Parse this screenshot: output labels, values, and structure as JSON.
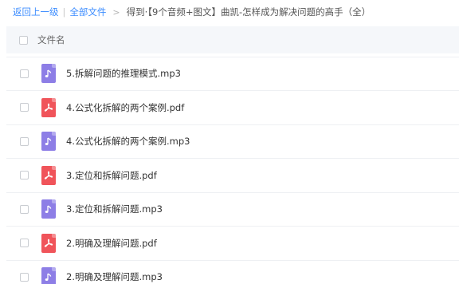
{
  "breadcrumb": {
    "back": "返回上一级",
    "separator": "|",
    "all_files": "全部文件",
    "arrow": ">",
    "current": "得到·【9个音频+图文】曲凯-怎样成为解决问题的高手（全）"
  },
  "table": {
    "header_label": "文件名"
  },
  "colors": {
    "pdf": "#f0545a",
    "audio": "#8d7ee6",
    "link": "#3b8cff"
  },
  "files": [
    {
      "name": "",
      "type": "pdf",
      "icon": "pdf-icon"
    },
    {
      "name": "5.拆解问题的推理模式.mp3",
      "type": "audio",
      "icon": "music-note-icon"
    },
    {
      "name": "4.公式化拆解的两个案例.pdf",
      "type": "pdf",
      "icon": "pdf-icon"
    },
    {
      "name": "4.公式化拆解的两个案例.mp3",
      "type": "audio",
      "icon": "music-note-icon"
    },
    {
      "name": "3.定位和拆解问题.pdf",
      "type": "pdf",
      "icon": "pdf-icon"
    },
    {
      "name": "3.定位和拆解问题.mp3",
      "type": "audio",
      "icon": "music-note-icon"
    },
    {
      "name": "2.明确及理解问题.pdf",
      "type": "pdf",
      "icon": "pdf-icon"
    },
    {
      "name": "2.明确及理解问题.mp3",
      "type": "audio",
      "icon": "music-note-icon"
    }
  ]
}
